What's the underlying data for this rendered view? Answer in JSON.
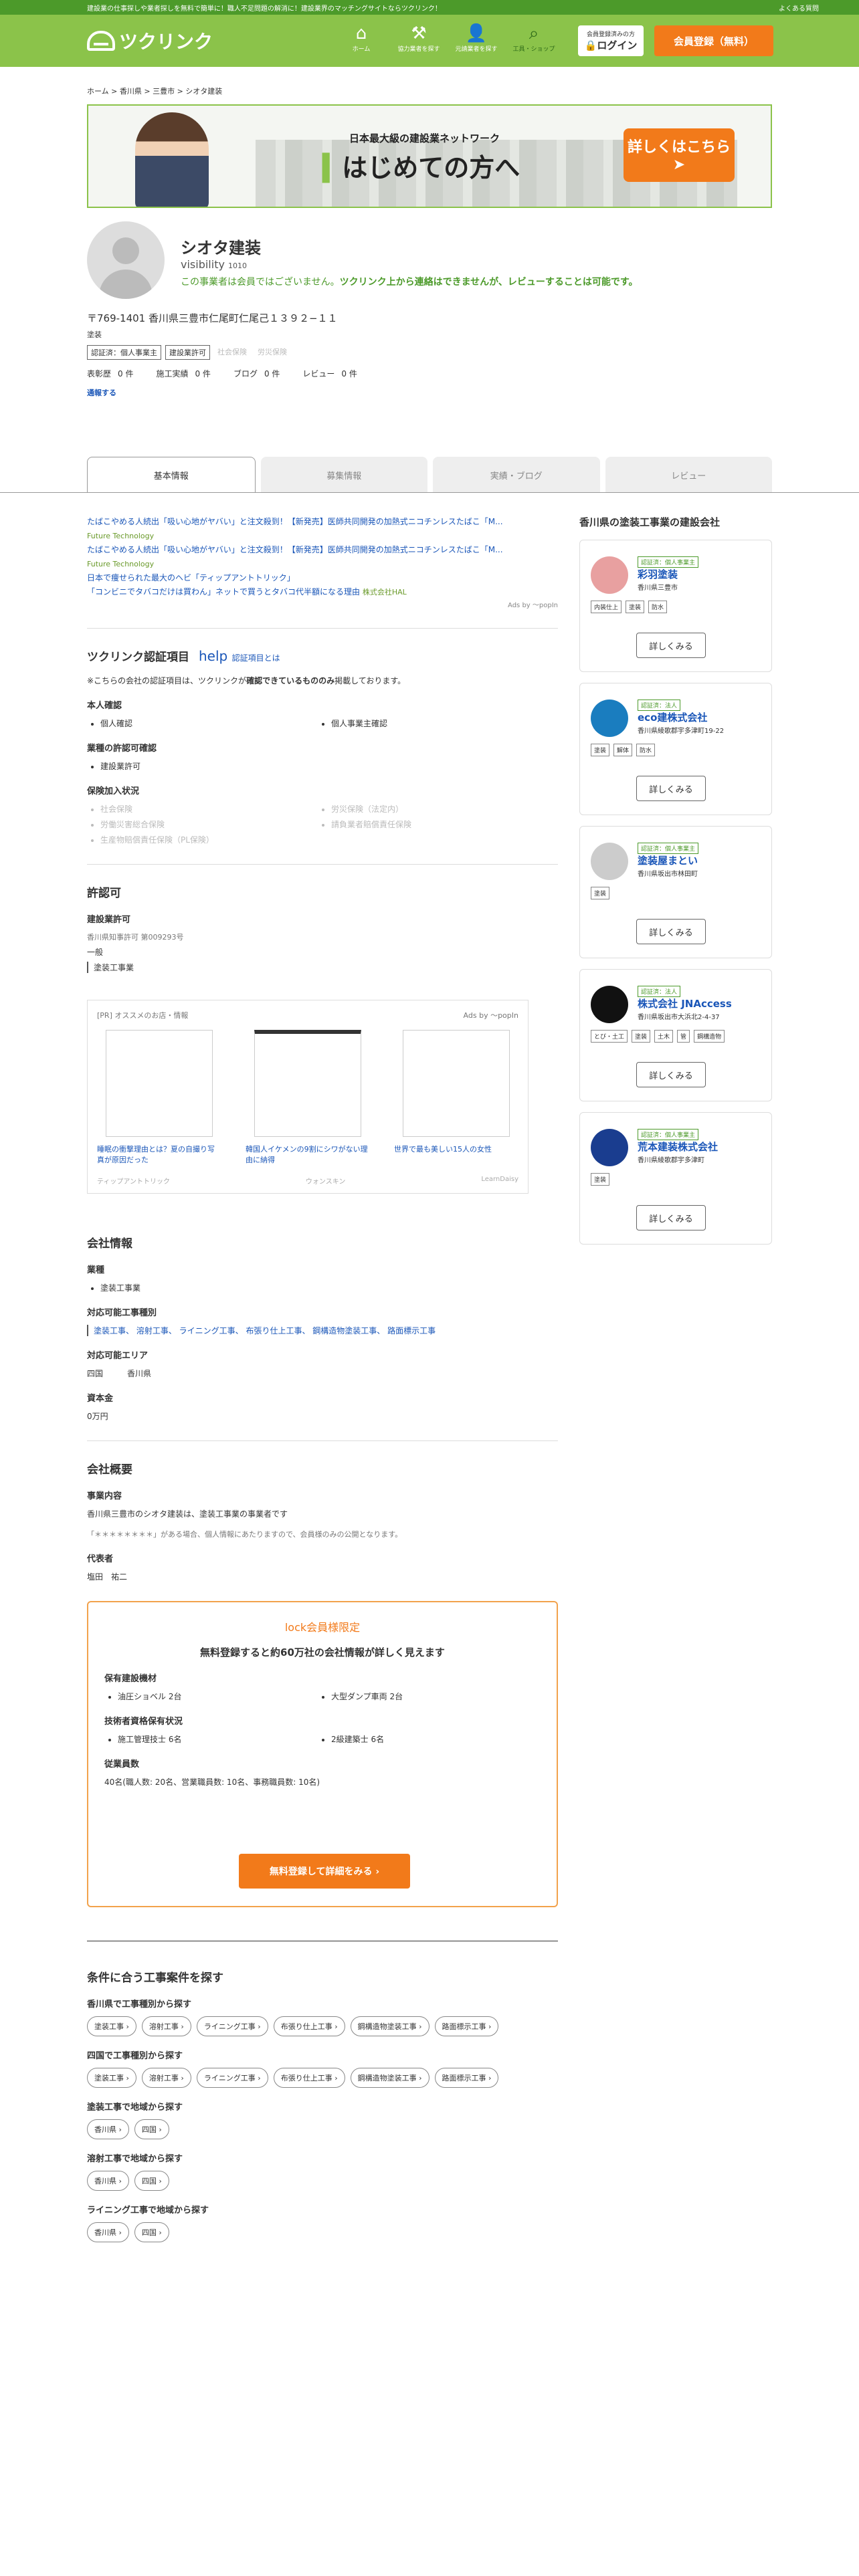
{
  "topbar": {
    "text": "建設業の仕事探しや業者探しを無料で簡単に！職人不足問題の解消に！建設業界のマッチングサイトならツクリンク！",
    "faq": "よくある質問"
  },
  "header": {
    "logo": "ツクリンク",
    "nav": [
      {
        "icon": "⌂",
        "label": "ホーム"
      },
      {
        "icon": "⚒",
        "label": "協力業者を探す"
      },
      {
        "icon": "👤",
        "label": "元請業者を探す"
      },
      {
        "icon": "⌕",
        "label": "工具・ショップ"
      }
    ],
    "login_small": "会員登録済みの方",
    "login": "ログイン",
    "register": "会員登録（無料）"
  },
  "crumb": "ホーム > 香川県 > 三豊市 > シオタ建装",
  "banner": {
    "tag": "日本最大級の建設業ネットワーク",
    "big_pre": "▍",
    "big": "はじめての方へ",
    "cta": "詳しくはこちら",
    "cta_arrow": "➤"
  },
  "profile": {
    "name": "シオタ建装",
    "views_label": "visibility",
    "views": "1010",
    "note_pre": "この事業者は会員ではございません。",
    "note_bold": "ツクリンク上から連絡はできませんが、レビューすることは可能です。",
    "address": "〒769-1401 香川県三豊市仁尾町仁尾己１３９２−１１",
    "category": "塗装",
    "badges": [
      {
        "label": "認証済：個人事業主",
        "on": true
      },
      {
        "label": "建設業許可",
        "on": true
      },
      {
        "label": "社会保険",
        "on": false
      },
      {
        "label": "労災保険",
        "on": false
      }
    ],
    "stats": [
      {
        "l": "表彰歴",
        "v": "0 件"
      },
      {
        "l": "施工実績",
        "v": "0 件"
      },
      {
        "l": "ブログ",
        "v": "0 件"
      },
      {
        "l": "レビュー",
        "v": "0 件"
      }
    ],
    "follow": "通報する"
  },
  "tabs": [
    "基本情報",
    "募集情報",
    "実績・ブログ",
    "レビュー"
  ],
  "ads": [
    {
      "t": "たばこやめる人続出「吸い心地がヤバい」と注文殺到！【新発売】医師共同開発の加熱式ニコチンレスたばこ「M...",
      "s": "Future Technology"
    },
    {
      "t": "たばこやめる人続出「吸い心地がヤバい」と注文殺到！【新発売】医師共同開発の加熱式ニコチンレスたばこ「M...",
      "s": "Future Technology"
    },
    {
      "t": "日本で痩せられた最大のヘビ「ティップアントトリック」",
      "s": ""
    },
    {
      "t": "「コンビニでタバコだけは買わん」ネットで買うとタバコ代半額になる理由",
      "s": "株式会社HAL"
    }
  ],
  "adby": "Ads by 〜popIn",
  "cert": {
    "title": "ツクリンク認証項目",
    "help": "help",
    "help_link": "認証項目とは",
    "note_pre": "※こちらの会社の認証項目は、ツクリンクが",
    "note_bold": "確認できているもののみ",
    "note_post": "掲載しております。",
    "h1": "本人確認",
    "id_items": [
      "個人確認",
      "個人事業主確認"
    ],
    "h2": "業種の許認可確認",
    "license_items": [
      "建設業許可"
    ],
    "h3": "保険加入状況",
    "ins_items": [
      "社会保険",
      "労災保険（法定内）",
      "労働災害総合保険",
      "請負業者賠償責任保険",
      "生産物賠償責任保険（PL保険）"
    ]
  },
  "permit": {
    "title": "許認可",
    "sub": "建設業許可",
    "num": "香川県知事許可 第009293号",
    "kind": "一般",
    "work": "塗装工事業"
  },
  "pr": {
    "head": "[PR] オススメのお店・情報",
    "by": "Ads by 〜popIn",
    "items": [
      {
        "cap": "睡眠の衝撃理由とは？夏の自撮り写真が原因だった",
        "src": "ティップアントトリック"
      },
      {
        "cap": "韓国人イケメンの9割にシワがない理由に納得",
        "src": "ウォンスキン"
      },
      {
        "cap": "世界で最も美しい15人の女性",
        "src": "LearnDaisy"
      }
    ]
  },
  "company": {
    "title": "会社情報",
    "h_type": "業種",
    "type": "塗装工事業",
    "h_works": "対応可能工事種別",
    "works": "塗装工事、 溶射工事、 ライニング工事、 布張り仕上工事、 鋼構造物塗装工事、 路面標示工事",
    "h_area": "対応可能エリア",
    "area1": "四国",
    "area2": "香川県",
    "h_cap": "資本金",
    "cap": "0万円"
  },
  "summary": {
    "title": "会社概要",
    "h_biz": "事業内容",
    "biz": "香川県三豊市のシオタ建装は、塗装工事業の事業者です",
    "mask": "「＊＊＊＊＊＊＊＊」がある場合、個人情報にあたりますので、会員様のみの公開となります。",
    "h_rep": "代表者",
    "rep": "塩田　祐二"
  },
  "members": {
    "t": "lock会員様限定",
    "s": "無料登録すると約60万社の会社情報が詳しく見えます",
    "h1": "保有建設機材",
    "eq": [
      "油圧ショベル 2台",
      "大型ダンプ車両 2台"
    ],
    "h2": "技術者資格保有状況",
    "qual": [
      "施工管理技士 6名",
      "2級建築士 6名"
    ],
    "h3": "従業員数",
    "emp": "40名(職人数: 20名、営業職員数: 10名、事務職員数: 10名)",
    "go": "無料登録して詳細をみる ›"
  },
  "search": {
    "title": "条件に合う工事案件を探す",
    "groups": [
      {
        "h": "香川県で工事種別から探す",
        "chips": [
          "塗装工事 ›",
          "溶射工事 ›",
          "ライニング工事 ›",
          "布張り仕上工事 ›",
          "鋼構造物塗装工事 ›",
          "路面標示工事 ›"
        ]
      },
      {
        "h": "四国で工事種別から探す",
        "chips": [
          "塗装工事 ›",
          "溶射工事 ›",
          "ライニング工事 ›",
          "布張り仕上工事 ›",
          "鋼構造物塗装工事 ›",
          "路面標示工事 ›"
        ]
      },
      {
        "h": "塗装工事で地域から探す",
        "chips": [
          "香川県 ›",
          "四国 ›"
        ]
      },
      {
        "h": "溶射工事で地域から探す",
        "chips": [
          "香川県 ›",
          "四国 ›"
        ]
      },
      {
        "h": "ライニング工事で地域から探す",
        "chips": [
          "香川県 ›",
          "四国 ›"
        ]
      }
    ]
  },
  "side": {
    "title": "香川県の塗装工事業の建設会社",
    "cards": [
      {
        "badge": "認証済：個人事業主",
        "name": "彩羽塗装",
        "addr": "香川県三豊市",
        "tags": [
          "内装仕上",
          "塗装",
          "防水"
        ],
        "more": "詳しくみる"
      },
      {
        "badge": "認証済：法人",
        "name": "eco建株式会社",
        "addr": "香川県綾歌郡宇多津町19-22",
        "tags": [
          "塗装",
          "解体",
          "防水"
        ],
        "more": "詳しくみる"
      },
      {
        "badge": "認証済：個人事業主",
        "name": "塗装屋まとい",
        "addr": "香川県坂出市林田町",
        "tags": [
          "塗装"
        ],
        "more": "詳しくみる"
      },
      {
        "badge": "認証済：法人",
        "name": "株式会社 JNAccess",
        "addr": "香川県坂出市大浜北2-4-37",
        "tags": [
          "とび・土工",
          "塗装",
          "土木",
          "管",
          "鋼構造物"
        ],
        "more": "詳しくみる"
      },
      {
        "badge": "認証済：個人事業主",
        "name": "荒本建装株式会社",
        "addr": "香川県綾歌郡宇多津町",
        "tags": [
          "塗装"
        ],
        "more": "詳しくみる"
      }
    ]
  }
}
